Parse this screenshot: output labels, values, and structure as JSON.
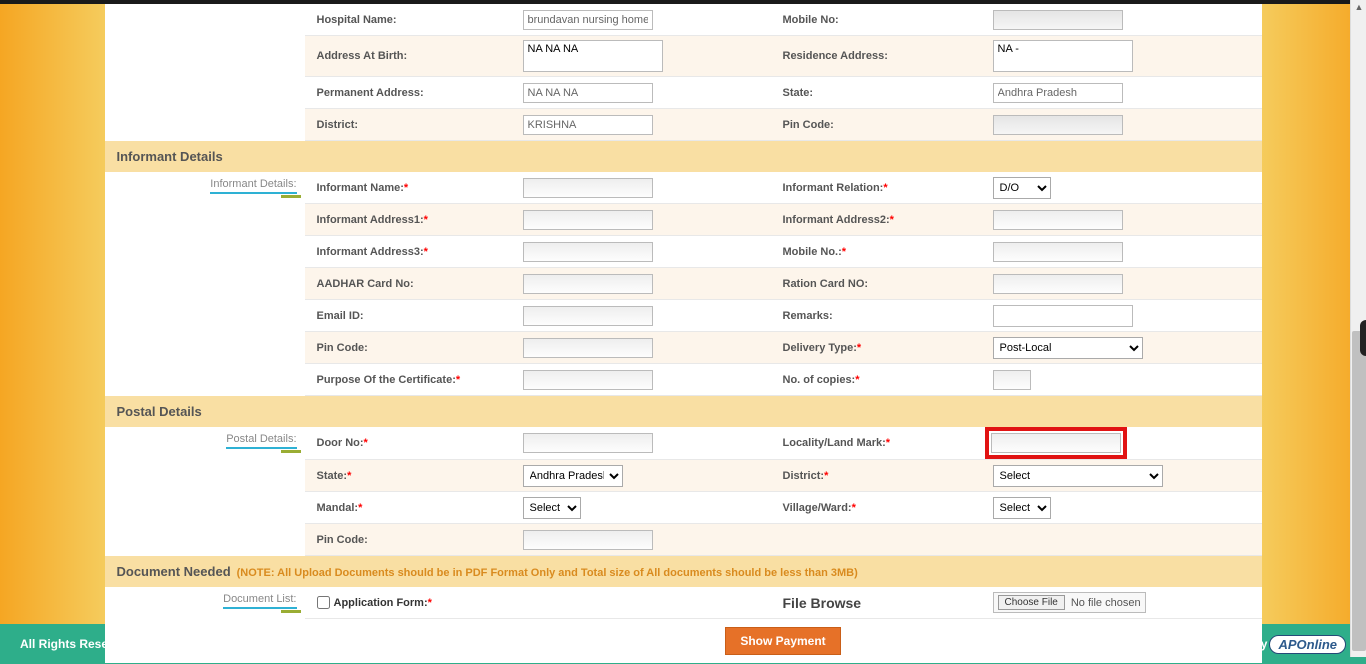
{
  "birth_details": {
    "hospital_name_label": "Hospital Name:",
    "hospital_name_value": "brundavan nursing home",
    "mobile_no_label": "Mobile No:",
    "mobile_no_value": "",
    "address_at_birth_label": "Address At Birth:",
    "address_at_birth_value": "NA NA NA",
    "residence_address_label": "Residence Address:",
    "residence_address_value": "NA -",
    "permanent_address_label": "Permanent Address:",
    "permanent_address_value": "NA NA NA",
    "state_label": "State:",
    "state_value": "Andhra Pradesh",
    "district_label": "District:",
    "district_value": "KRISHNA",
    "pin_code_label": "Pin Code:",
    "pin_code_value": ""
  },
  "informant_section": {
    "header": "Informant Details",
    "side_label": "Informant Details:",
    "informant_name_label": "Informant Name:",
    "informant_relation_label": "Informant Relation:",
    "informant_relation_value": "D/O",
    "informant_address1_label": "Informant Address1:",
    "informant_address2_label": "Informant Address2:",
    "informant_address3_label": "Informant Address3:",
    "mobile_no_label": "Mobile No.:",
    "aadhar_label": "AADHAR Card No:",
    "ration_label": "Ration Card NO:",
    "email_label": "Email ID:",
    "remarks_label": "Remarks:",
    "pin_label": "Pin Code:",
    "delivery_type_label": "Delivery Type:",
    "delivery_type_value": "Post-Local",
    "purpose_label": "Purpose Of the Certificate:",
    "copies_label": "No. of copies:"
  },
  "postal_section": {
    "header": "Postal Details",
    "side_label": "Postal Details:",
    "door_no_label": "Door No:",
    "locality_label": "Locality/Land Mark:",
    "state_label": "State:",
    "state_value": "Andhra Pradesh",
    "district_label": "District:",
    "district_value": "Select",
    "mandal_label": "Mandal:",
    "mandal_value": "Select",
    "village_label": "Village/Ward:",
    "village_value": "Select",
    "pin_label": "Pin Code:"
  },
  "document_section": {
    "header": "Document Needed",
    "note": "(NOTE: All Upload Documents should be in PDF Format Only and Total size of All documents should be less than 3MB)",
    "side_label": "Document List:",
    "app_form_label": "Application Form:",
    "file_browse_label": "File Browse",
    "choose_file_btn": "Choose File",
    "no_file_text": "No file chosen"
  },
  "show_payment_btn": "Show Payment",
  "footer": {
    "left": "All Rights Reserved with Director, Electronic Services Delivery.",
    "right": "Designed & Developed by",
    "logo_text": "APOnline"
  }
}
